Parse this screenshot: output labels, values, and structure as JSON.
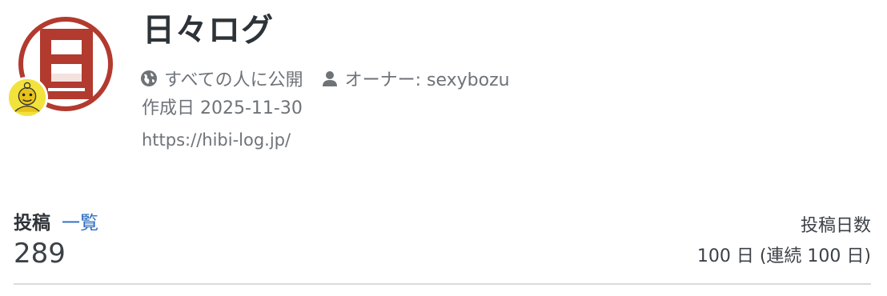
{
  "profile": {
    "title": "日々ログ",
    "visibility": "すべての人に公開",
    "owner": "オーナー: sexybozu",
    "created": "作成日 2025-11-30",
    "url": "https://hibi-log.jp/",
    "avatar_glyph": "日",
    "visibility_icon": "globe-icon",
    "owner_icon": "user-icon"
  },
  "stats": {
    "posts_label": "投稿",
    "posts_link": "一覧",
    "posts_count": "289",
    "days_label": "投稿日数",
    "days_value": "100 日 (連続 100 日)"
  },
  "colors": {
    "avatar_red": "#b23a2e",
    "link_blue": "#2a6bbf",
    "text_dark": "#2e3338",
    "text_muted": "#6e7378"
  }
}
